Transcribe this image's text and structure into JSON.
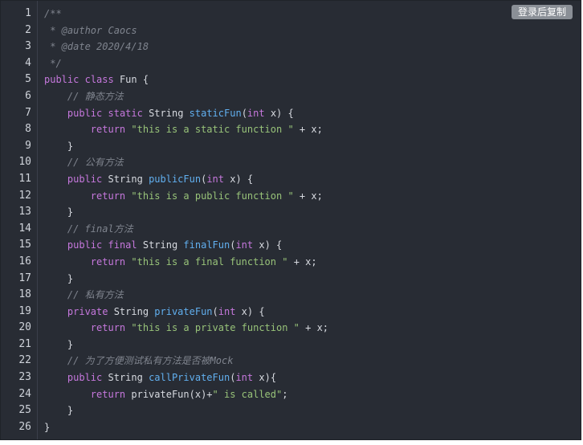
{
  "copy_button": {
    "label": "登录后复制"
  },
  "colors": {
    "background": "#282c34",
    "comment": "#7f848e",
    "keyword": "#c678dd",
    "string": "#98c379",
    "function": "#61afef",
    "plain": "#d7dae0"
  },
  "code": {
    "lines": [
      {
        "num": "1",
        "tokens": [
          {
            "t": "comment",
            "v": "/**"
          }
        ]
      },
      {
        "num": "2",
        "tokens": [
          {
            "t": "comment",
            "v": " * @author Caocs"
          }
        ]
      },
      {
        "num": "3",
        "tokens": [
          {
            "t": "comment",
            "v": " * @date 2020/4/18"
          }
        ]
      },
      {
        "num": "4",
        "tokens": [
          {
            "t": "comment",
            "v": " */"
          }
        ]
      },
      {
        "num": "5",
        "tokens": [
          {
            "t": "keyword",
            "v": "public"
          },
          {
            "t": "plain",
            "v": " "
          },
          {
            "t": "keyword",
            "v": "class"
          },
          {
            "t": "plain",
            "v": " Fun {"
          }
        ]
      },
      {
        "num": "6",
        "tokens": [
          {
            "t": "plain",
            "v": "    "
          },
          {
            "t": "comment",
            "v": "// 静态方法"
          }
        ]
      },
      {
        "num": "7",
        "tokens": [
          {
            "t": "plain",
            "v": "    "
          },
          {
            "t": "keyword",
            "v": "public"
          },
          {
            "t": "plain",
            "v": " "
          },
          {
            "t": "keyword",
            "v": "static"
          },
          {
            "t": "plain",
            "v": " String "
          },
          {
            "t": "func",
            "v": "staticFun"
          },
          {
            "t": "plain",
            "v": "("
          },
          {
            "t": "keyword",
            "v": "int"
          },
          {
            "t": "plain",
            "v": " x) {"
          }
        ]
      },
      {
        "num": "8",
        "tokens": [
          {
            "t": "plain",
            "v": "        "
          },
          {
            "t": "keyword",
            "v": "return"
          },
          {
            "t": "plain",
            "v": " "
          },
          {
            "t": "string",
            "v": "\"this is a static function \""
          },
          {
            "t": "plain",
            "v": " + x;"
          }
        ]
      },
      {
        "num": "9",
        "tokens": [
          {
            "t": "plain",
            "v": "    }"
          }
        ]
      },
      {
        "num": "10",
        "tokens": [
          {
            "t": "plain",
            "v": "    "
          },
          {
            "t": "comment",
            "v": "// 公有方法"
          }
        ]
      },
      {
        "num": "11",
        "tokens": [
          {
            "t": "plain",
            "v": "    "
          },
          {
            "t": "keyword",
            "v": "public"
          },
          {
            "t": "plain",
            "v": " String "
          },
          {
            "t": "func",
            "v": "publicFun"
          },
          {
            "t": "plain",
            "v": "("
          },
          {
            "t": "keyword",
            "v": "int"
          },
          {
            "t": "plain",
            "v": " x) {"
          }
        ]
      },
      {
        "num": "12",
        "tokens": [
          {
            "t": "plain",
            "v": "        "
          },
          {
            "t": "keyword",
            "v": "return"
          },
          {
            "t": "plain",
            "v": " "
          },
          {
            "t": "string",
            "v": "\"this is a public function \""
          },
          {
            "t": "plain",
            "v": " + x;"
          }
        ]
      },
      {
        "num": "13",
        "tokens": [
          {
            "t": "plain",
            "v": "    }"
          }
        ]
      },
      {
        "num": "14",
        "tokens": [
          {
            "t": "plain",
            "v": "    "
          },
          {
            "t": "comment",
            "v": "// final方法"
          }
        ]
      },
      {
        "num": "15",
        "tokens": [
          {
            "t": "plain",
            "v": "    "
          },
          {
            "t": "keyword",
            "v": "public"
          },
          {
            "t": "plain",
            "v": " "
          },
          {
            "t": "keyword",
            "v": "final"
          },
          {
            "t": "plain",
            "v": " String "
          },
          {
            "t": "func",
            "v": "finalFun"
          },
          {
            "t": "plain",
            "v": "("
          },
          {
            "t": "keyword",
            "v": "int"
          },
          {
            "t": "plain",
            "v": " x) {"
          }
        ]
      },
      {
        "num": "16",
        "tokens": [
          {
            "t": "plain",
            "v": "        "
          },
          {
            "t": "keyword",
            "v": "return"
          },
          {
            "t": "plain",
            "v": " "
          },
          {
            "t": "string",
            "v": "\"this is a final function \""
          },
          {
            "t": "plain",
            "v": " + x;"
          }
        ]
      },
      {
        "num": "17",
        "tokens": [
          {
            "t": "plain",
            "v": "    }"
          }
        ]
      },
      {
        "num": "18",
        "tokens": [
          {
            "t": "plain",
            "v": "    "
          },
          {
            "t": "comment",
            "v": "// 私有方法"
          }
        ]
      },
      {
        "num": "19",
        "tokens": [
          {
            "t": "plain",
            "v": "    "
          },
          {
            "t": "keyword",
            "v": "private"
          },
          {
            "t": "plain",
            "v": " String "
          },
          {
            "t": "func",
            "v": "privateFun"
          },
          {
            "t": "plain",
            "v": "("
          },
          {
            "t": "keyword",
            "v": "int"
          },
          {
            "t": "plain",
            "v": " x) {"
          }
        ]
      },
      {
        "num": "20",
        "tokens": [
          {
            "t": "plain",
            "v": "        "
          },
          {
            "t": "keyword",
            "v": "return"
          },
          {
            "t": "plain",
            "v": " "
          },
          {
            "t": "string",
            "v": "\"this is a private function \""
          },
          {
            "t": "plain",
            "v": " + x;"
          }
        ]
      },
      {
        "num": "21",
        "tokens": [
          {
            "t": "plain",
            "v": "    }"
          }
        ]
      },
      {
        "num": "22",
        "tokens": [
          {
            "t": "plain",
            "v": "    "
          },
          {
            "t": "comment",
            "v": "// 为了方便测试私有方法是否被Mock"
          }
        ]
      },
      {
        "num": "23",
        "tokens": [
          {
            "t": "plain",
            "v": "    "
          },
          {
            "t": "keyword",
            "v": "public"
          },
          {
            "t": "plain",
            "v": " String "
          },
          {
            "t": "func",
            "v": "callPrivateFun"
          },
          {
            "t": "plain",
            "v": "("
          },
          {
            "t": "keyword",
            "v": "int"
          },
          {
            "t": "plain",
            "v": " x){"
          }
        ]
      },
      {
        "num": "24",
        "tokens": [
          {
            "t": "plain",
            "v": "        "
          },
          {
            "t": "keyword",
            "v": "return"
          },
          {
            "t": "plain",
            "v": " privateFun(x)+"
          },
          {
            "t": "string",
            "v": "\" is called\""
          },
          {
            "t": "plain",
            "v": ";"
          }
        ]
      },
      {
        "num": "25",
        "tokens": [
          {
            "t": "plain",
            "v": "    }"
          }
        ]
      },
      {
        "num": "26",
        "tokens": [
          {
            "t": "plain",
            "v": "}"
          }
        ]
      }
    ]
  }
}
